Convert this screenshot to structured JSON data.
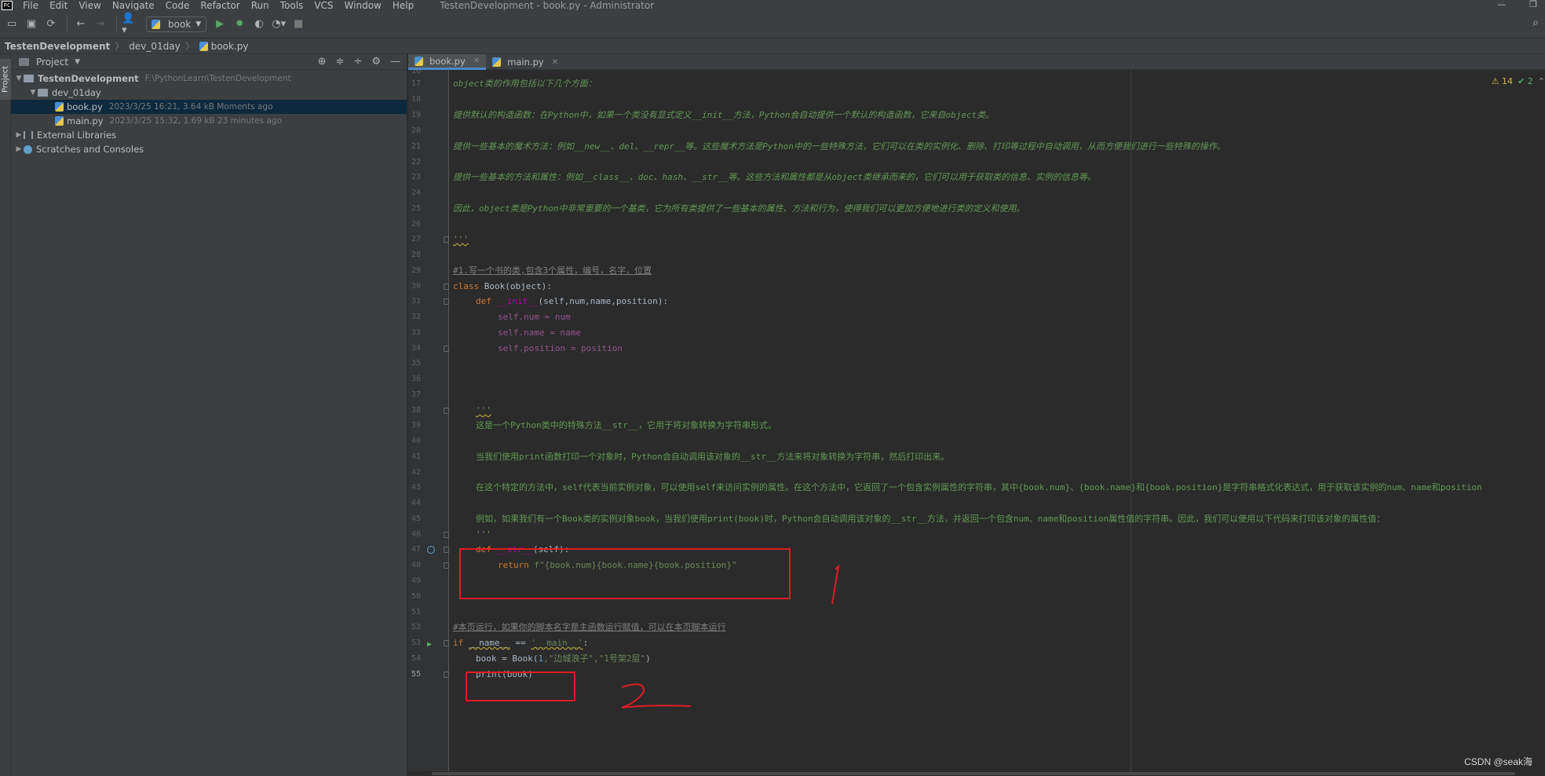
{
  "menubar": {
    "logo": "PC",
    "items": [
      "File",
      "Edit",
      "View",
      "Navigate",
      "Code",
      "Refactor",
      "Run",
      "Tools",
      "VCS",
      "Window",
      "Help"
    ],
    "window_title": "TestenDevelopment - book.py - Administrator",
    "controls": [
      "—",
      "❐"
    ]
  },
  "toolbar": {
    "run_config": "book"
  },
  "breadcrumb": [
    "TestenDevelopment",
    "dev_01day",
    "book.py"
  ],
  "left_strip": {
    "label": "Project"
  },
  "project_panel": {
    "title": "Project",
    "tree": [
      {
        "name": "TestenDevelopment",
        "meta": "F:\\PythonLearn\\TestenDevelopment",
        "bold": true
      },
      {
        "name": "dev_01day",
        "meta": ""
      },
      {
        "name": "book.py",
        "meta": "2023/3/25 16:21, 3.64 kB Moments ago"
      },
      {
        "name": "main.py",
        "meta": "2023/3/25 15:32, 1.69 kB 23 minutes ago"
      },
      {
        "name": "External Libraries",
        "meta": ""
      },
      {
        "name": "Scratches and Consoles",
        "meta": ""
      }
    ]
  },
  "editor_tabs": [
    {
      "label": "book.py",
      "active": true
    },
    {
      "label": "main.py",
      "active": false
    }
  ],
  "inspections": {
    "warnings": "⚠ 14",
    "checks": "✔ 2"
  },
  "code": {
    "l16": "",
    "l17": "object类的作用包括以下几个方面：",
    "l19": "提供默认的构造函数：在Python中，如果一个类没有显式定义__init__方法，Python会自动提供一个默认的构造函数，它来自object类。",
    "l21": "提供一些基本的魔术方法：例如__new__、del、__repr__等。这些魔术方法是Python中的一些特殊方法，它们可以在类的实例化、删除、打印等过程中自动调用，从而方便我们进行一些特殊的操作。",
    "l23": "提供一些基本的方法和属性：例如__class__、doc、hash、__str__等。这些方法和属性都是从object类继承而来的，它们可以用于获取类的信息、实例的信息等。",
    "l25": "因此，object类是Python中非常重要的一个基类，它为所有类提供了一些基本的属性、方法和行为，使得我们可以更加方便地进行类的定义和使用。",
    "l27": "'''",
    "l29": "#1.写一个书的类,包含3个属性，编号，名字，位置",
    "l30_kw": "class ",
    "l30_name": "Book",
    "l30_rest": "(object):",
    "l31_kw": "def ",
    "l31_fn": "__init__",
    "l31_rest": "(self,num,name,position):",
    "l32": "self.num = num",
    "l33": "self.name = name",
    "l34": "self.position = position",
    "l38": "'''",
    "l39": "这是一个Python类中的特殊方法__str__，它用于将对象转换为字符串形式。",
    "l41": "当我们使用print函数打印一个对象时，Python会自动调用该对象的__str__方法来将对象转换为字符串，然后打印出来。",
    "l43": "在这个特定的方法中，self代表当前实例对象，可以使用self来访问实例的属性。在这个方法中，它返回了一个包含实例属性的字符串，其中{book.num}、{book.name}和{book.position}是字符串格式化表达式，用于获取该实例的num、name和position",
    "l45": "例如，如果我们有一个Book类的实例对象book，当我们使用print(book)时，Python会自动调用该对象的__str__方法，并返回一个包含num、name和position属性值的字符串。因此，我们可以使用以下代码来打印该对象的属性值：",
    "l46": "'''",
    "l47_kw": "def ",
    "l47_fn": "__str__",
    "l47_rest": "(self):",
    "l48_kw": "return ",
    "l48_str": "f\"{book.num}{book.name}{book.position}\"",
    "l52": "#本页运行，如果你的脚本名字是主函数运行赋值，可以在本页脚本运行",
    "l53_kw": "if ",
    "l53_name": "__name__",
    "l53_op": " == ",
    "l53_str": "'__main__'",
    "l53_end": ":",
    "l54_pre": "book = Book(",
    "l54_num": "1",
    "l54_s1": ",\"边城浪子\"",
    "l54_s2": ",\"1号架2层\"",
    "l54_end": ")",
    "l55": "print(book)"
  },
  "annotations": {
    "mark1": "1",
    "mark2": "2"
  },
  "watermark": "CSDN @seak海"
}
